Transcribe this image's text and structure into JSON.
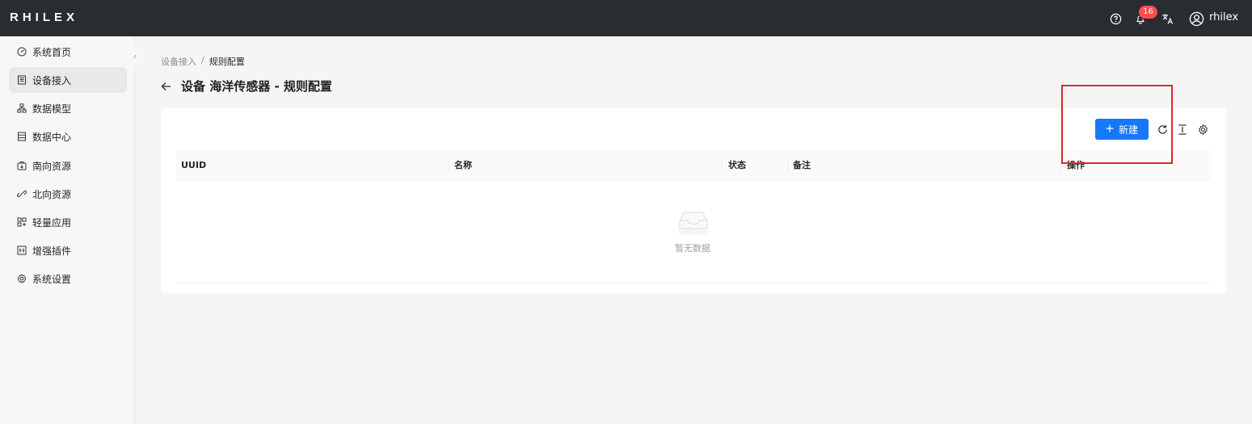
{
  "app": {
    "logo": "RHILEX"
  },
  "topbar": {
    "notification_count": "16",
    "username": "rhilex",
    "icons": [
      "help-icon",
      "bell-icon",
      "translate-icon",
      "user-icon"
    ]
  },
  "sidebar": {
    "items": [
      {
        "label": "系统首页",
        "icon": "dashboard-icon"
      },
      {
        "label": "设备接入",
        "icon": "device-icon",
        "active": true
      },
      {
        "label": "数据模型",
        "icon": "model-icon"
      },
      {
        "label": "数据中心",
        "icon": "datacenter-icon"
      },
      {
        "label": "南向资源",
        "icon": "southbound-icon"
      },
      {
        "label": "北向资源",
        "icon": "northbound-icon"
      },
      {
        "label": "轻量应用",
        "icon": "app-icon"
      },
      {
        "label": "增强插件",
        "icon": "plugin-icon"
      },
      {
        "label": "系统设置",
        "icon": "settings-icon"
      }
    ]
  },
  "breadcrumb": {
    "parent": "设备接入",
    "separator": "/",
    "current": "规则配置"
  },
  "page": {
    "title": "设备 海洋传感器 - 规则配置"
  },
  "toolbar": {
    "new_label": "新建",
    "new_icon": "plus-icon"
  },
  "table": {
    "columns": [
      "UUID",
      "名称",
      "状态",
      "备注",
      "操作"
    ],
    "rows": [],
    "empty_text": "暂无数据"
  },
  "colors": {
    "primary": "#1677ff",
    "topbar": "#292c31",
    "badge": "#ff4d4f",
    "highlight": "#d92b2b"
  }
}
